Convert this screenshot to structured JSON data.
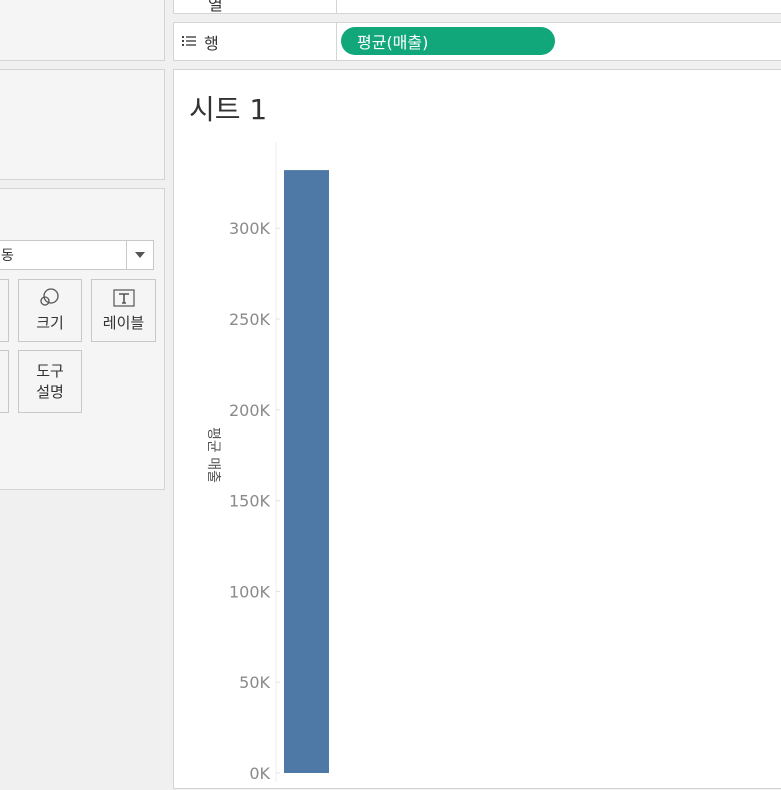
{
  "shelves": {
    "columns": {
      "label": "열",
      "value": ""
    },
    "rows": {
      "label": "행",
      "pill": "평균(매출)"
    }
  },
  "marks": {
    "type_selected": "동",
    "buttons": {
      "size": "크기",
      "label": "레이블",
      "tooltip_line1": "도구",
      "tooltip_line2": "설명"
    }
  },
  "sheet": {
    "title": "시트 1"
  },
  "chart_data": {
    "type": "bar",
    "title": "시트 1",
    "categories": [
      ""
    ],
    "values": [
      332000
    ],
    "ylabel": "평균 매출",
    "xlabel": "",
    "ylim": [
      0,
      345000
    ],
    "yticks": [
      {
        "value": 0,
        "label": "0K"
      },
      {
        "value": 50000,
        "label": "50K"
      },
      {
        "value": 100000,
        "label": "100K"
      },
      {
        "value": 150000,
        "label": "150K"
      },
      {
        "value": 200000,
        "label": "200K"
      },
      {
        "value": 250000,
        "label": "250K"
      },
      {
        "value": 300000,
        "label": "300K"
      }
    ],
    "bar_color": "#4e79a7",
    "grid": false
  }
}
